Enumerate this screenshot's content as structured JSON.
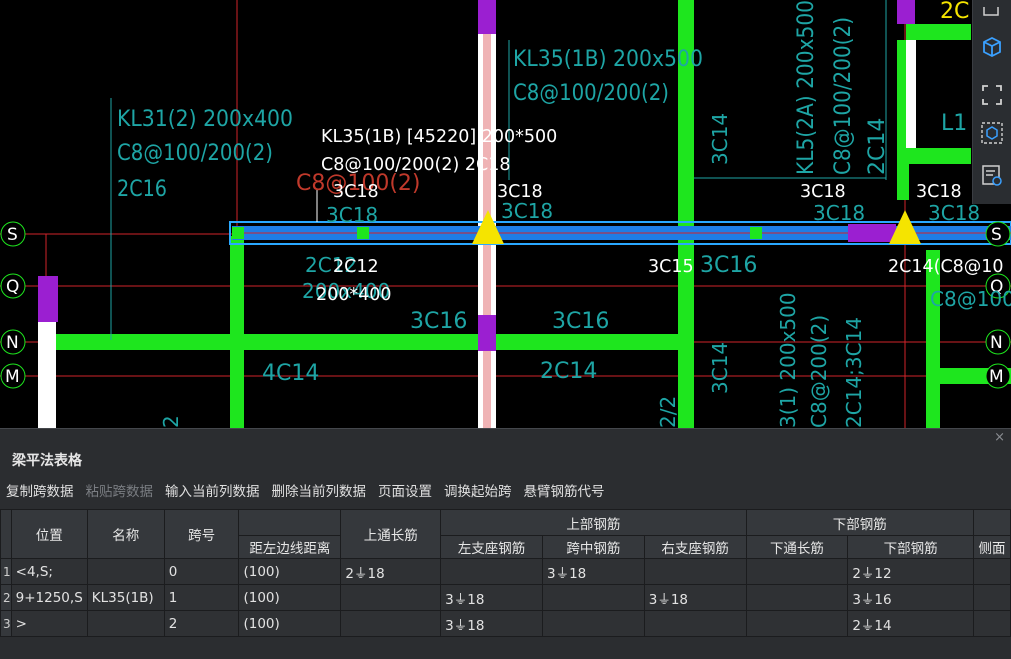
{
  "cad": {
    "axes": [
      "S",
      "Q",
      "N",
      "M"
    ],
    "annotations": {
      "kl31_line1": "KL31(2) 200x400",
      "kl31_line2": "C8@100/200(2)",
      "kl31_line3": "2C16",
      "kl35_v_line1": "KL35(1B) 200x500",
      "kl35_v_line2": "C8@100/200(2)",
      "kl5_v_line1": "KL5(2A) 200x500",
      "kl5_v_line2": "C8@100/200(2)",
      "kl5_v_line3": "2C14",
      "c14_v": "3C14",
      "l1_partial": "L1",
      "top_yellow_partial": "2C",
      "active_line1": "KL35(1B) [45220] 200*500",
      "active_line2": "C8@100/200(2) 2C18",
      "red_ghost": "C8@100(2)",
      "top_3c18_a": "3C18",
      "top_3c18_b": "3C18",
      "top_3c18_c": "3C18",
      "top_3c18_d": "3C18",
      "ghost_3c18_a": "3C18",
      "ghost_3c18_b": "3C18",
      "ghost_3c18_c": "3C18",
      "ghost_3c18_d": "3C18",
      "bottom_2c12": "2C12",
      "ghost_200_400": "200x400",
      "bottom_200_400": "200*400",
      "bot_3c16_a": "3C16",
      "bot_3c16_b": "3C16",
      "bot_3c16_c": "3C16",
      "bot_3c15": "3C15",
      "mid_2c14": "2C14",
      "mid_4c14": "4C14",
      "right_2c14": "2C14(C8@10",
      "right_ghost": "C8@100(",
      "lower_v_1": "3(1) 200x500",
      "lower_v_2": "C8@200(2)",
      "lower_v_3": "2C14;3C14",
      "lower_v_4": "3C14",
      "left_v_2": "2",
      "mid_v_2": "2/2"
    }
  },
  "panel": {
    "title": "梁平法表格",
    "close": "×",
    "menu": [
      {
        "label": "复制跨数据",
        "enabled": true
      },
      {
        "label": "粘贴跨数据",
        "enabled": false
      },
      {
        "label": "输入当前列数据",
        "enabled": true
      },
      {
        "label": "删除当前列数据",
        "enabled": true
      },
      {
        "label": "页面设置",
        "enabled": true
      },
      {
        "label": "调换起始跨",
        "enabled": true
      },
      {
        "label": "悬臂钢筋代号",
        "enabled": true
      }
    ],
    "headers": {
      "position": "位置",
      "name": "名称",
      "span": "跨号",
      "dist_left": "距左边线距离",
      "top_through": "上通长筋",
      "top_group": "上部钢筋",
      "top_left": "左支座钢筋",
      "top_mid": "跨中钢筋",
      "top_right": "右支座钢筋",
      "bottom_group": "下部钢筋",
      "bottom_through": "下通长筋",
      "bottom_bars": "下部钢筋",
      "side": "侧面"
    },
    "rows": [
      {
        "num": "1",
        "position": "<4,S;",
        "name": "",
        "span": "0",
        "dist_left": "(100)",
        "top_through": "2⏚18",
        "top_left": "",
        "top_mid": "3⏚18",
        "top_right": "",
        "bottom_through": "",
        "bottom_bars": "2⏚12",
        "side": ""
      },
      {
        "num": "2",
        "position": "9+1250,S",
        "name": "KL35(1B)",
        "span": "1",
        "dist_left": "(100)",
        "top_through": "",
        "top_left": "3⏚18",
        "top_mid": "",
        "top_right": "3⏚18",
        "bottom_through": "",
        "bottom_bars": "3⏚16",
        "side": ""
      },
      {
        "num": "3",
        "position": ">",
        "name": "",
        "span": "2",
        "dist_left": "(100)",
        "top_through": "",
        "top_left": "3⏚18",
        "top_mid": "",
        "top_right": "",
        "bottom_through": "",
        "bottom_bars": "2⏚14",
        "side": ""
      }
    ]
  }
}
